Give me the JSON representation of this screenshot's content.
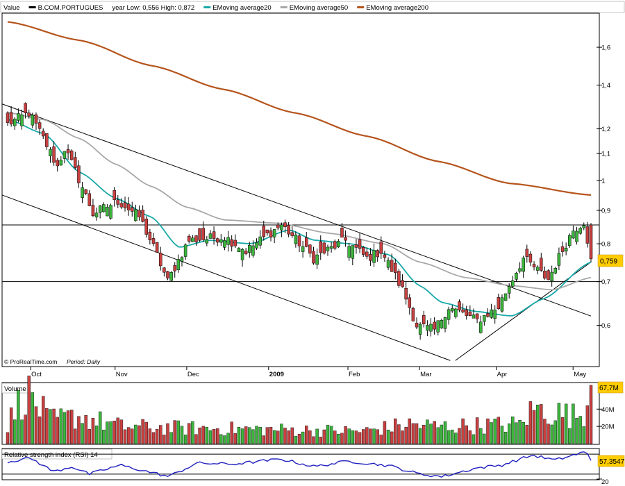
{
  "main_panel": {
    "legend": [
      {
        "text": "Value",
        "color": "#000000",
        "swatch": false
      },
      {
        "text": "B.COM.PORTUGUES",
        "color": "#000000",
        "swatch": true
      },
      {
        "text": "year Low: 0,556 High: 0,872",
        "color": "#000000",
        "swatch": false
      },
      {
        "text": "EMoving average20",
        "color": "#1aa8a8",
        "swatch": true
      },
      {
        "text": "EMoving average50",
        "color": "#a8a8a8",
        "swatch": true
      },
      {
        "text": "EMoving average200",
        "color": "#b5541c",
        "swatch": true
      }
    ],
    "y_ticks": [
      "1,6",
      "1,4",
      "1,2",
      "1,1",
      "1",
      "0,9",
      "0,8",
      "0,7",
      "0,6"
    ],
    "x_ticks": [
      {
        "label": "Oct",
        "bold": false
      },
      {
        "label": "Nov",
        "bold": false
      },
      {
        "label": "Dec",
        "bold": false
      },
      {
        "label": "2009",
        "bold": true
      },
      {
        "label": "Feb",
        "bold": false
      },
      {
        "label": "Mar",
        "bold": false
      },
      {
        "label": "Apr",
        "bold": false
      },
      {
        "label": "May",
        "bold": false
      }
    ],
    "last_price_label": "0,759",
    "credit": "© ProRealTime.com",
    "period_label": "Period: Daily"
  },
  "volume_panel": {
    "title": "Volume",
    "y_ticks": [
      "40M",
      "20M"
    ],
    "last_label": "67,7M"
  },
  "rsi_panel": {
    "title": "Relative strength index (RSI) 14",
    "y_ticks": [
      "20"
    ],
    "last_label": "57,3547"
  },
  "colors": {
    "up": "#3cb43c",
    "down": "#c84040",
    "ema20": "#1aa8a8",
    "ema50": "#a8a8a8",
    "ema200": "#b5541c",
    "rsi": "#2020c0",
    "price_label_bg": "#ffcc00"
  },
  "chart_data": [
    {
      "type": "candlestick",
      "title": "B.COM.PORTUGUES",
      "scale": "log",
      "ylim": [
        0.52,
        1.8
      ],
      "x_range": [
        "2008-09-22",
        "2009-05-08"
      ],
      "horizontal_lines": [
        0.855,
        0.7
      ],
      "trendlines": [
        {
          "from": [
            "2008-09-16",
            1.31
          ],
          "to": [
            "2009-05-08",
            0.62
          ]
        },
        {
          "from": [
            "2008-09-16",
            0.95
          ],
          "to": [
            "2009-03-14",
            0.53
          ]
        },
        {
          "from": [
            "2009-03-16",
            0.53
          ],
          "to": [
            "2009-05-08",
            0.75
          ]
        }
      ],
      "candle_anchors": [
        {
          "date": "2008-09-22",
          "close": 1.22
        },
        {
          "date": "2008-09-30",
          "close": 1.27
        },
        {
          "date": "2008-10-10",
          "close": 1.05
        },
        {
          "date": "2008-10-14",
          "close": 1.12
        },
        {
          "date": "2008-10-24",
          "close": 0.89
        },
        {
          "date": "2008-11-04",
          "close": 0.93
        },
        {
          "date": "2008-11-12",
          "close": 0.88
        },
        {
          "date": "2008-11-24",
          "close": 0.7
        },
        {
          "date": "2008-12-02",
          "close": 0.81
        },
        {
          "date": "2008-12-16",
          "close": 0.82
        },
        {
          "date": "2008-12-24",
          "close": 0.78
        },
        {
          "date": "2009-01-07",
          "close": 0.855
        },
        {
          "date": "2009-01-20",
          "close": 0.76
        },
        {
          "date": "2009-02-02",
          "close": 0.81
        },
        {
          "date": "2009-02-10",
          "close": 0.76
        },
        {
          "date": "2009-02-16",
          "close": 0.78
        },
        {
          "date": "2009-02-24",
          "close": 0.68
        },
        {
          "date": "2009-03-02",
          "close": 0.6
        },
        {
          "date": "2009-03-09",
          "close": 0.59
        },
        {
          "date": "2009-03-13",
          "close": 0.64
        },
        {
          "date": "2009-03-25",
          "close": 0.61
        },
        {
          "date": "2009-04-02",
          "close": 0.64
        },
        {
          "date": "2009-04-13",
          "close": 0.76
        },
        {
          "date": "2009-04-22",
          "close": 0.705
        },
        {
          "date": "2009-05-01",
          "close": 0.84
        },
        {
          "date": "2009-05-06",
          "close": 0.865
        },
        {
          "date": "2009-05-08",
          "close": 0.759
        }
      ],
      "series": [
        {
          "name": "EMoving average20",
          "points": [
            [
              "2008-09-22",
              1.24
            ],
            [
              "2008-10-06",
              1.18
            ],
            [
              "2008-10-20",
              1.03
            ],
            [
              "2008-11-03",
              0.94
            ],
            [
              "2008-11-17",
              0.88
            ],
            [
              "2008-11-28",
              0.79
            ],
            [
              "2008-12-10",
              0.81
            ],
            [
              "2008-12-26",
              0.8
            ],
            [
              "2009-01-10",
              0.84
            ],
            [
              "2009-01-20",
              0.81
            ],
            [
              "2009-02-03",
              0.8
            ],
            [
              "2009-02-18",
              0.77
            ],
            [
              "2009-03-02",
              0.69
            ],
            [
              "2009-03-11",
              0.65
            ],
            [
              "2009-03-24",
              0.63
            ],
            [
              "2009-04-07",
              0.62
            ],
            [
              "2009-04-20",
              0.66
            ],
            [
              "2009-05-08",
              0.75
            ]
          ]
        },
        {
          "name": "EMoving average50",
          "points": [
            [
              "2008-09-22",
              1.27
            ],
            [
              "2008-10-06",
              1.24
            ],
            [
              "2008-10-20",
              1.16
            ],
            [
              "2008-11-03",
              1.06
            ],
            [
              "2008-11-17",
              0.98
            ],
            [
              "2008-12-01",
              0.91
            ],
            [
              "2008-12-16",
              0.87
            ],
            [
              "2009-01-06",
              0.86
            ],
            [
              "2009-01-26",
              0.83
            ],
            [
              "2009-02-16",
              0.8
            ],
            [
              "2009-03-02",
              0.75
            ],
            [
              "2009-03-20",
              0.71
            ],
            [
              "2009-04-07",
              0.69
            ],
            [
              "2009-04-23",
              0.68
            ],
            [
              "2009-05-08",
              0.71
            ]
          ]
        },
        {
          "name": "EMoving average200",
          "points": [
            [
              "2008-09-22",
              1.75
            ],
            [
              "2008-10-20",
              1.64
            ],
            [
              "2008-11-17",
              1.5
            ],
            [
              "2008-12-15",
              1.38
            ],
            [
              "2009-01-12",
              1.27
            ],
            [
              "2009-02-09",
              1.17
            ],
            [
              "2009-03-09",
              1.07
            ],
            [
              "2009-04-06",
              0.99
            ],
            [
              "2009-05-08",
              0.95
            ]
          ]
        }
      ],
      "last_close": 0.759
    },
    {
      "type": "bar",
      "title": "Volume",
      "ylim": [
        0,
        70
      ],
      "unit": "M",
      "volume_anchors": [
        {
          "date": "2008-09-22",
          "value": 25
        },
        {
          "date": "2008-09-29",
          "value": 68
        },
        {
          "date": "2008-10-08",
          "value": 30
        },
        {
          "date": "2008-10-20",
          "value": 35
        },
        {
          "date": "2008-11-05",
          "value": 22
        },
        {
          "date": "2008-12-01",
          "value": 20
        },
        {
          "date": "2009-01-06",
          "value": 18
        },
        {
          "date": "2009-02-09",
          "value": 16
        },
        {
          "date": "2009-02-26",
          "value": 25
        },
        {
          "date": "2009-03-10",
          "value": 22
        },
        {
          "date": "2009-04-10",
          "value": 25
        },
        {
          "date": "2009-04-16",
          "value": 45
        },
        {
          "date": "2009-05-04",
          "value": 35
        },
        {
          "date": "2009-05-07",
          "value": 48
        },
        {
          "date": "2009-05-08",
          "value": 67.7
        }
      ],
      "last_value": 67.7
    },
    {
      "type": "line",
      "title": "Relative strength index (RSI) 14",
      "ylim": [
        20,
        80
      ],
      "series": [
        {
          "name": "Relative strength index (RSI) 14",
          "points": [
            [
              "2008-09-22",
              55
            ],
            [
              "2008-10-01",
              62
            ],
            [
              "2008-10-10",
              35
            ],
            [
              "2008-10-17",
              45
            ],
            [
              "2008-10-24",
              30
            ],
            [
              "2008-11-05",
              48
            ],
            [
              "2008-11-24",
              25
            ],
            [
              "2008-12-05",
              52
            ],
            [
              "2008-12-19",
              50
            ],
            [
              "2009-01-07",
              60
            ],
            [
              "2009-01-20",
              45
            ],
            [
              "2009-02-02",
              56
            ],
            [
              "2009-02-18",
              47
            ],
            [
              "2009-03-02",
              30
            ],
            [
              "2009-03-11",
              25
            ],
            [
              "2009-03-24",
              42
            ],
            [
              "2009-04-03",
              48
            ],
            [
              "2009-04-15",
              68
            ],
            [
              "2009-04-24",
              58
            ],
            [
              "2009-05-06",
              75
            ],
            [
              "2009-05-08",
              57.35
            ]
          ]
        }
      ],
      "last_value": 57.3547
    }
  ]
}
